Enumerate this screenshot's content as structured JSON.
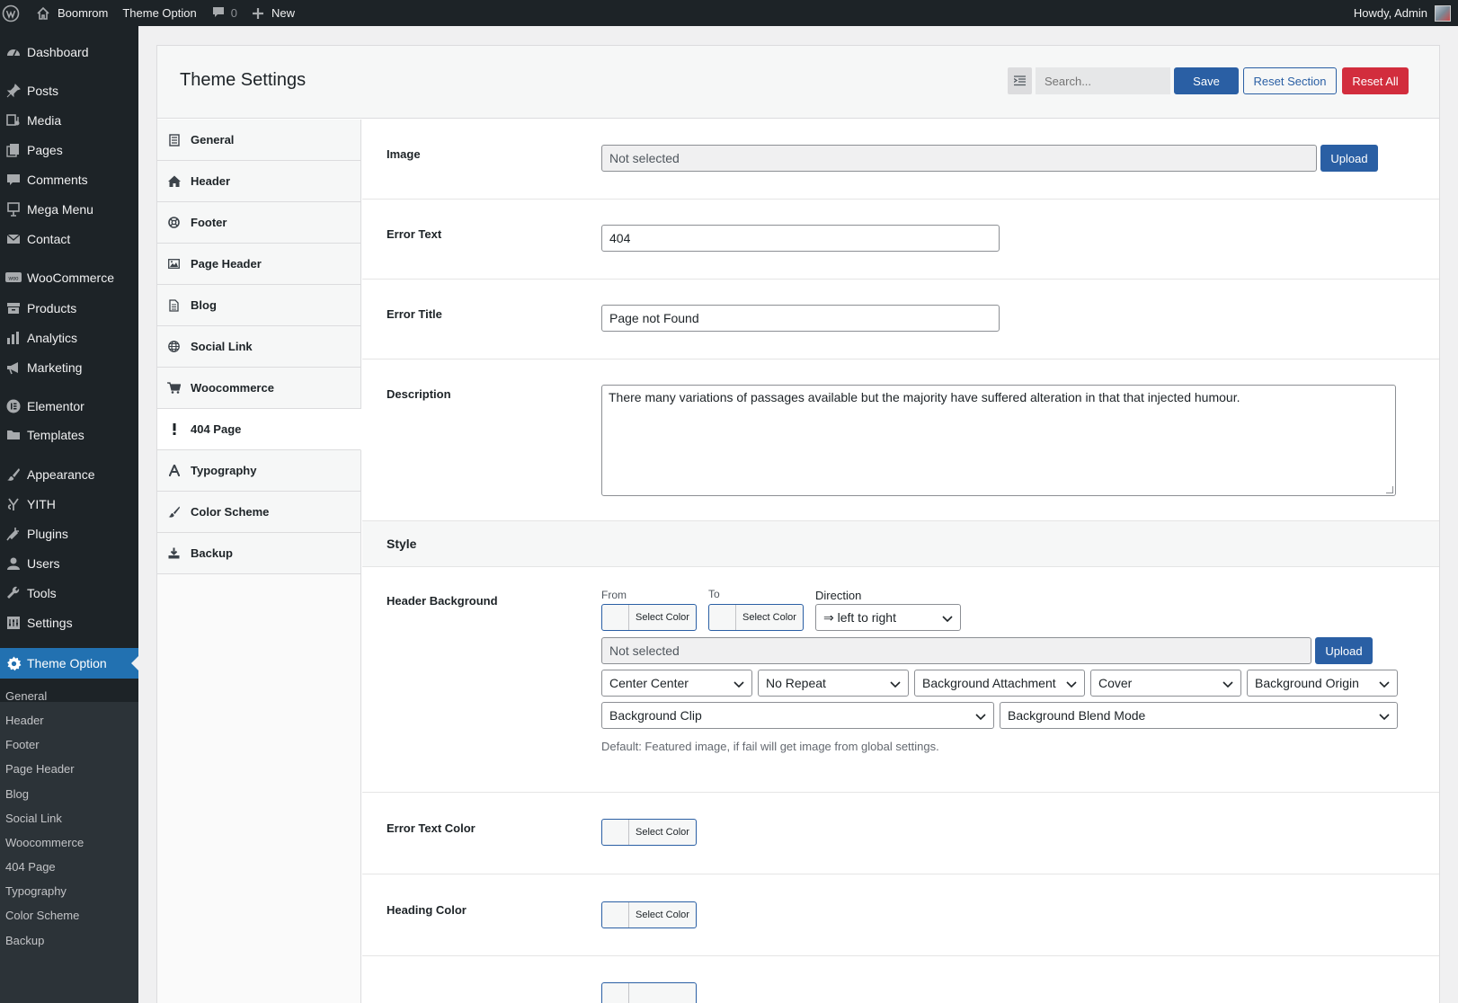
{
  "adminbar": {
    "site_name": "Boomrom",
    "theme_option": "Theme Option",
    "comments_count": "0",
    "new_label": "New",
    "howdy": "Howdy, Admin"
  },
  "sidebar": {
    "items": [
      {
        "label": "Dashboard",
        "icon": "dashboard-icon"
      },
      {
        "label": "Posts",
        "icon": "pin-icon"
      },
      {
        "label": "Media",
        "icon": "media-icon"
      },
      {
        "label": "Pages",
        "icon": "pages-icon"
      },
      {
        "label": "Comments",
        "icon": "comment-icon"
      },
      {
        "label": "Mega Menu",
        "icon": "mega-menu-icon"
      },
      {
        "label": "Contact",
        "icon": "mail-icon"
      },
      {
        "label": "WooCommerce",
        "icon": "woo-icon"
      },
      {
        "label": "Products",
        "icon": "archive-icon"
      },
      {
        "label": "Analytics",
        "icon": "bar-chart-icon"
      },
      {
        "label": "Marketing",
        "icon": "megaphone-icon"
      },
      {
        "label": "Elementor",
        "icon": "elementor-icon"
      },
      {
        "label": "Templates",
        "icon": "folder-icon"
      },
      {
        "label": "Appearance",
        "icon": "brush-icon"
      },
      {
        "label": "YITH",
        "icon": "yith-icon"
      },
      {
        "label": "Plugins",
        "icon": "plug-icon"
      },
      {
        "label": "Users",
        "icon": "user-icon"
      },
      {
        "label": "Tools",
        "icon": "wrench-icon"
      },
      {
        "label": "Settings",
        "icon": "settings-icon"
      },
      {
        "label": "Theme Option",
        "icon": "gear-icon"
      }
    ],
    "submenu": [
      "General",
      "Header",
      "Footer",
      "Page Header",
      "Blog",
      "Social Link",
      "Woocommerce",
      "404 Page",
      "Typography",
      "Color Scheme",
      "Backup"
    ]
  },
  "panel": {
    "title": "Theme Settings",
    "search_placeholder": "Search...",
    "save_label": "Save",
    "reset_section_label": "Reset Section",
    "reset_all_label": "Reset All"
  },
  "tabs": [
    {
      "label": "General",
      "icon": "document-icon"
    },
    {
      "label": "Header",
      "icon": "home-icon"
    },
    {
      "label": "Footer",
      "icon": "life-ring-icon"
    },
    {
      "label": "Page Header",
      "icon": "image-icon"
    },
    {
      "label": "Blog",
      "icon": "file-icon"
    },
    {
      "label": "Social Link",
      "icon": "globe-icon"
    },
    {
      "label": "Woocommerce",
      "icon": "cart-icon"
    },
    {
      "label": "404 Page",
      "icon": "exclamation-icon"
    },
    {
      "label": "Typography",
      "icon": "font-icon"
    },
    {
      "label": "Color Scheme",
      "icon": "brush-icon"
    },
    {
      "label": "Backup",
      "icon": "download-icon"
    }
  ],
  "fields": {
    "image": {
      "label": "Image",
      "value": "Not selected",
      "button": "Upload"
    },
    "error_text": {
      "label": "Error Text",
      "value": "404"
    },
    "error_title": {
      "label": "Error Title",
      "value": "Page not Found"
    },
    "description": {
      "label": "Description",
      "value": "There many variations of passages available but the majority have suffered alteration in that that injected humour."
    },
    "style_section": "Style",
    "header_background": {
      "label": "Header Background",
      "from_label": "From",
      "to_label": "To",
      "direction_label": "Direction",
      "select_color": "Select Color",
      "direction_value": "⇒ left to right",
      "image_value": "Not selected",
      "upload": "Upload",
      "position": "Center Center",
      "repeat": "No Repeat",
      "attachment": "Background Attachment",
      "size": "Cover",
      "origin": "Background Origin",
      "clip": "Background Clip",
      "blend": "Background Blend Mode",
      "help": "Default: Featured image, if fail will get image from global settings."
    },
    "error_text_color": {
      "label": "Error Text Color",
      "button": "Select Color"
    },
    "heading_color": {
      "label": "Heading Color",
      "button": "Select Color"
    }
  }
}
